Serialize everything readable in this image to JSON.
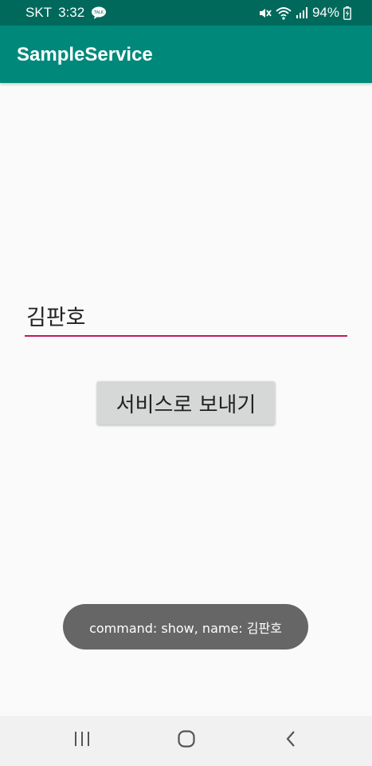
{
  "status_bar": {
    "carrier": "SKT",
    "time": "3:32",
    "battery": "94%",
    "icons": [
      "talk-icon",
      "mute-icon",
      "wifi-icon",
      "signal-icon",
      "battery-icon"
    ]
  },
  "app_bar": {
    "title": "SampleService"
  },
  "form": {
    "name_value": "김판호",
    "send_button_label": "서비스로 보내기"
  },
  "toast": {
    "message": "command: show, name: 김판호"
  },
  "nav_bar": {
    "icons": [
      "recents-icon",
      "home-icon",
      "back-icon"
    ]
  },
  "colors": {
    "status_bar": "#00695c",
    "app_bar": "#00897b",
    "accent": "#c2185b",
    "toast": "#666666"
  }
}
